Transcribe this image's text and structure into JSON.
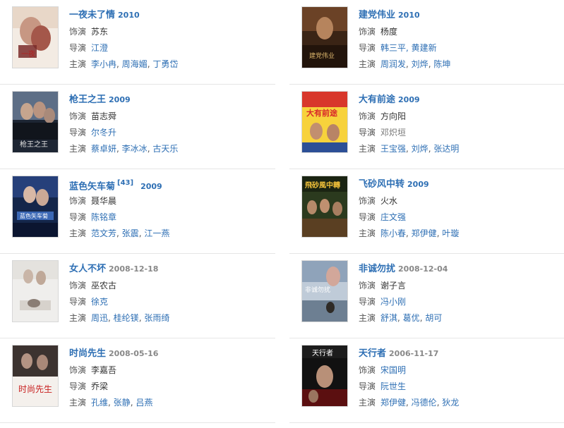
{
  "labels": {
    "role": "饰演",
    "director": "导演",
    "starring": "主演"
  },
  "movies": [
    {
      "title": "一夜未了情",
      "year": "2010",
      "role": "苏东",
      "director": "江澄",
      "cast": [
        "李小冉",
        "周海媚",
        "丁勇岱"
      ]
    },
    {
      "title": "建党伟业",
      "year": "2010",
      "role": "杨度",
      "director": "韩三平, 黄建新",
      "cast": [
        "周润发",
        "刘烨",
        "陈坤"
      ]
    },
    {
      "title": "枪王之王",
      "year": "2009",
      "role": "苗志舜",
      "director": "尔冬升",
      "cast": [
        "蔡卓妍",
        "李冰冰",
        "古天乐"
      ]
    },
    {
      "title": "大有前途",
      "year": "2009",
      "role": "方向阳",
      "director": "邓炽垣",
      "cast": [
        "王宝强",
        "刘烨",
        "张达明"
      ]
    },
    {
      "title": "蓝色矢车菊",
      "ref": "[43]",
      "year": "2009",
      "role": "聂华晨",
      "director": "陈铭章",
      "cast": [
        "范文芳",
        "张震",
        "江一燕"
      ]
    },
    {
      "title": "飞砂风中转",
      "year": "2009",
      "role": "火水",
      "director": "庄文强",
      "cast": [
        "陈小春",
        "郑伊健",
        "叶璇"
      ]
    },
    {
      "title": "女人不坏",
      "year": "2008-12-18",
      "role": "巫农古",
      "director": "徐克",
      "cast": [
        "周迅",
        "桂纶镁",
        "张雨绮"
      ]
    },
    {
      "title": "非诚勿扰",
      "year": "2008-12-04",
      "role": "谢子言",
      "director": "冯小刚",
      "cast": [
        "舒淇",
        "葛优",
        "胡可"
      ]
    },
    {
      "title": "时尚先生",
      "year": "2008-05-16",
      "role": "李嘉吾",
      "director": "乔梁",
      "cast": [
        "孔维",
        "张静",
        "吕燕"
      ]
    },
    {
      "title": "天行者",
      "year": "2006-11-17",
      "role": "宋国明",
      "director": "阮世生",
      "cast": [
        "郑伊健",
        "冯德伦",
        "狄龙"
      ]
    }
  ]
}
